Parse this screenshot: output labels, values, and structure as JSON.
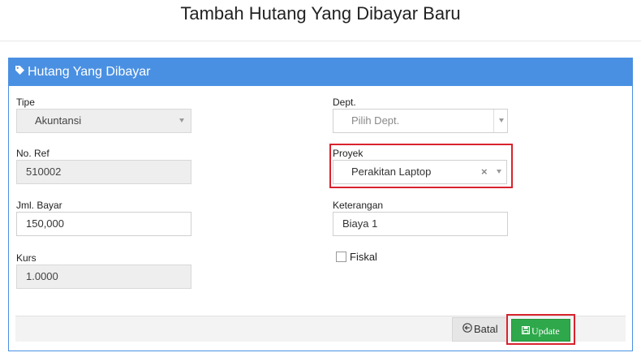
{
  "page": {
    "title": "Tambah Hutang Yang Dibayar Baru"
  },
  "panel": {
    "title": "Hutang Yang Dibayar"
  },
  "form": {
    "tipe": {
      "label": "Tipe",
      "value": "Akuntansi"
    },
    "dept": {
      "label": "Dept.",
      "placeholder": "Pilih Dept."
    },
    "no_ref": {
      "label": "No. Ref",
      "value": "510002"
    },
    "proyek": {
      "label": "Proyek",
      "value": "Perakitan Laptop",
      "clear": "×"
    },
    "jml_bayar": {
      "label": "Jml. Bayar",
      "value": "150,000"
    },
    "keterangan": {
      "label": "Keterangan",
      "value": "Biaya 1"
    },
    "kurs": {
      "label": "Kurs",
      "value": "1.0000"
    },
    "fiskal": {
      "label": "Fiskal",
      "checked": false
    }
  },
  "actions": {
    "cancel_label": "Batal",
    "update_label": "Update"
  },
  "colors": {
    "header_blue": "#4a90e2",
    "update_green": "#2ea84a",
    "highlight_red": "#d9232d"
  }
}
